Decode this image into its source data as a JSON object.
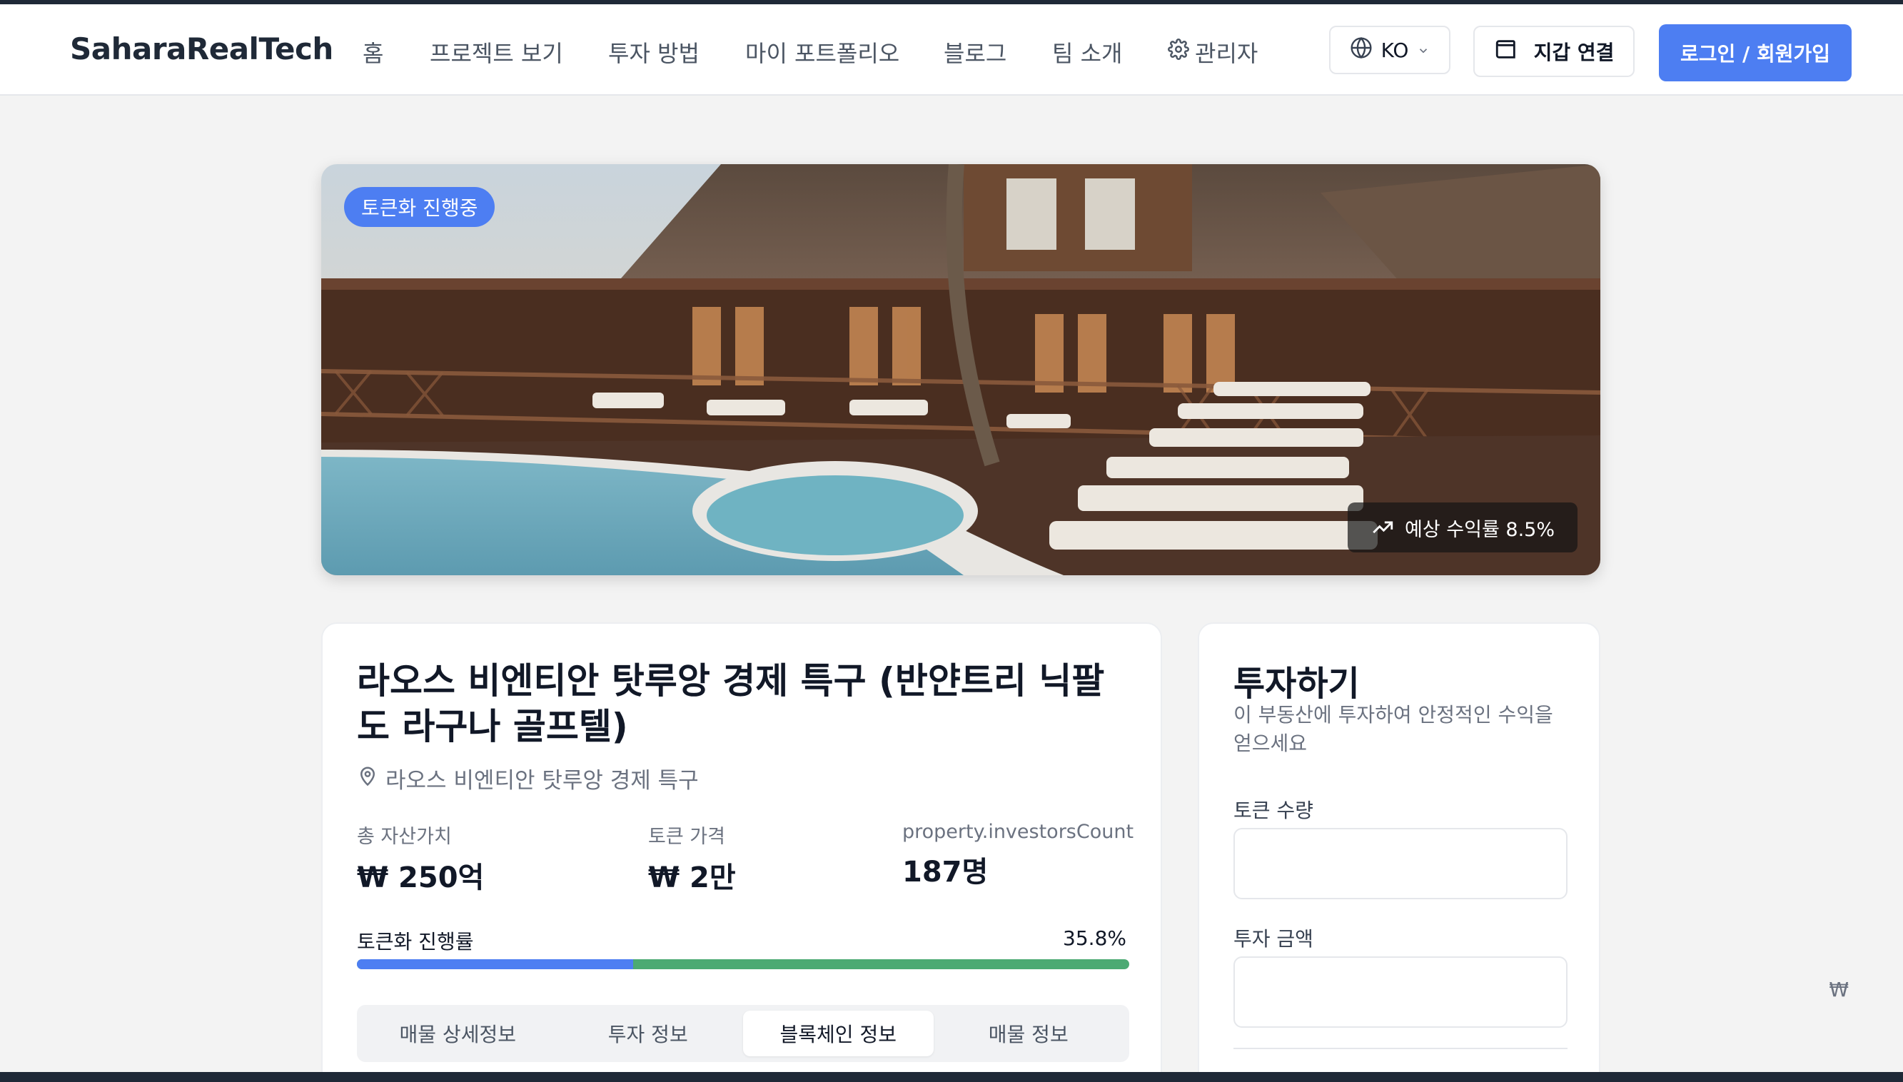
{
  "header": {
    "brand": "SaharaRealTech",
    "nav": [
      {
        "label": "홈"
      },
      {
        "label": "프로젝트 보기"
      },
      {
        "label": "투자 방법"
      },
      {
        "label": "마이 포트폴리오"
      },
      {
        "label": "블로그"
      },
      {
        "label": "팀 소개"
      },
      {
        "label": "관리자",
        "icon": "gear-icon"
      }
    ],
    "language": {
      "label": "KO",
      "icon": "globe-icon"
    },
    "wallet": {
      "label": "지갑 연결",
      "icon": "wallet-icon"
    },
    "login": {
      "label": "로그인 / 회원가입"
    },
    "colors": {
      "accent": "#4d7ef2"
    }
  },
  "hero": {
    "status_badge": "토큰화 진행중",
    "yield_badge": "예상 수익률 8.5%",
    "yield_icon": "trending-up-icon"
  },
  "property": {
    "title": "라오스 비엔티안 탓루앙 경제 특구 (반얀트리 닉팔도 라구나 골프텔)",
    "location": "라오스 비엔티안 탓루앙 경제 특구",
    "location_icon": "map-pin-icon",
    "stats": [
      {
        "label": "총 자산가치",
        "value": "₩ 250억"
      },
      {
        "label": "토큰 가격",
        "value": "₩ 2만"
      },
      {
        "label": "property.investorsCount",
        "value": "187명"
      }
    ],
    "progress": {
      "label": "토큰화 진행률",
      "value_text": "35.8%",
      "value": 35.8,
      "colors": {
        "fill": "#4d7ef2",
        "track": "#4caa73"
      }
    },
    "tabs": [
      {
        "label": "매물 상세정보",
        "active": false
      },
      {
        "label": "투자 정보",
        "active": false
      },
      {
        "label": "블록체인 정보",
        "active": true
      },
      {
        "label": "매물 정보",
        "active": false
      }
    ]
  },
  "invest": {
    "title": "투자하기",
    "subtitle": "이 부동산에 투자하여 안정적인 수익을 얻으세요",
    "token_qty_label": "토큰 수량",
    "token_qty_value": "",
    "amount_label": "투자 금액",
    "amount_value": "",
    "currency_suffix": "₩"
  }
}
